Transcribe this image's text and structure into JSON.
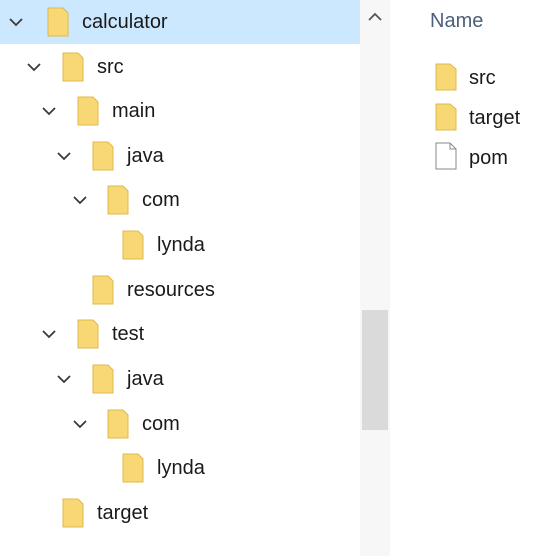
{
  "tree": {
    "root": {
      "label": "calculator"
    },
    "src": {
      "label": "src"
    },
    "main": {
      "label": "main"
    },
    "main_java": {
      "label": "java"
    },
    "main_com": {
      "label": "com"
    },
    "main_lynda": {
      "label": "lynda"
    },
    "resources": {
      "label": "resources"
    },
    "test": {
      "label": "test"
    },
    "test_java": {
      "label": "java"
    },
    "test_com": {
      "label": "com"
    },
    "test_lynda": {
      "label": "lynda"
    },
    "target": {
      "label": "target"
    }
  },
  "list": {
    "header": "Name",
    "items": [
      {
        "label": "src",
        "type": "folder"
      },
      {
        "label": "target",
        "type": "folder"
      },
      {
        "label": "pom",
        "type": "file"
      }
    ]
  },
  "colors": {
    "selection": "#cce8ff",
    "folder": "#f8d775",
    "folder_dark": "#e0b84a"
  }
}
